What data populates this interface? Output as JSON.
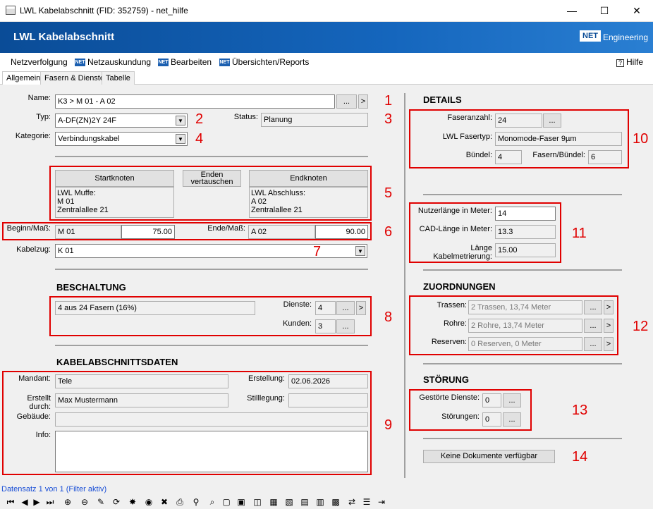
{
  "window": {
    "title": "LWL Kabelabschnitt (FID: 352759) - net_hilfe",
    "min": "—",
    "max": "☐",
    "close": "✕"
  },
  "banner": {
    "title": "LWL Kabelabschnitt",
    "logo": "NET",
    "logo_text": "Engineering"
  },
  "menu": {
    "items": [
      "Netzverfolgung",
      "Netzauskundung",
      "Bearbeiten",
      "Übersichten/Reports"
    ],
    "help": "Hilfe",
    "net": "NET"
  },
  "tabs": [
    "Allgemein",
    "Fasern & Dienste",
    "Tabelle"
  ],
  "general": {
    "name_label": "Name:",
    "name_value": "K3 > M 01 - A 02",
    "dots": "...",
    "arrow": ">",
    "typ_label": "Typ:",
    "typ_value": "A-DF(ZN)2Y 24F",
    "status_label": "Status:",
    "status_value": "Planung",
    "kategorie_label": "Kategorie:",
    "kategorie_value": "Verbindungskabel",
    "startknoten": "Startknoten",
    "enden_vertauschen": "Enden vertauschen",
    "endknoten": "Endknoten",
    "start_info": [
      "LWL Muffe:",
      "M 01",
      "Zentralallee 21"
    ],
    "end_info": [
      "LWL Abschluss:",
      "A 02",
      "Zentralallee 21"
    ],
    "beginn_label": "Beginn/Maß:",
    "beginn_name": "M 01",
    "beginn_mass": "75.00",
    "ende_label": "Ende/Maß:",
    "ende_name": "A 02",
    "ende_mass": "90.00",
    "kabelzug_label": "Kabelzug:",
    "kabelzug_value": "K 01"
  },
  "beschaltung": {
    "title": "BESCHALTUNG",
    "fasern": "4 aus 24 Fasern (16%)",
    "dienste_label": "Dienste:",
    "dienste_value": "4",
    "kunden_label": "Kunden:",
    "kunden_value": "3"
  },
  "kabeldaten": {
    "title": "KABELABSCHNITTSDATEN",
    "mandant_label": "Mandant:",
    "mandant_value": "Tele",
    "erstellung_label": "Erstellung:",
    "erstellung_value": "02.06.2026",
    "erstellt_label": "Erstellt durch:",
    "erstellt_value": "Max Mustermann",
    "stilllegung_label": "Stilllegung:",
    "stilllegung_value": "",
    "gebaeude_label": "Gebäude:",
    "gebaeude_value": "",
    "info_label": "Info:",
    "info_value": ""
  },
  "details": {
    "title": "DETAILS",
    "faseranzahl_label": "Faseranzahl:",
    "faseranzahl_value": "24",
    "fasertyp_label": "LWL Fasertyp:",
    "fasertyp_value": "Monomode-Faser 9µm",
    "buendel_label": "Bündel:",
    "buendel_value": "4",
    "fpb_label": "Fasern/Bündel:",
    "fpb_value": "6"
  },
  "laengen": {
    "nutzer_label": "Nutzerlänge in Meter:",
    "nutzer_value": "14",
    "cad_label": "CAD-Länge in Meter:",
    "cad_value": "13.3",
    "kmetr_label": "Länge Kabelmetrierung:",
    "kmetr_value": "15.00"
  },
  "zuordnungen": {
    "title": "ZUORDNUNGEN",
    "trassen_label": "Trassen:",
    "trassen_value": "2 Trassen, 13,74 Meter",
    "rohre_label": "Rohre:",
    "rohre_value": "2 Rohre, 13,74 Meter",
    "reserven_label": "Reserven:",
    "reserven_value": "0 Reserven, 0 Meter"
  },
  "stoerung": {
    "title": "STÖRUNG",
    "dienste_label": "Gestörte Dienste:",
    "dienste_value": "0",
    "stoerungen_label": "Störungen:",
    "stoerungen_value": "0"
  },
  "dokumente": "Keine Dokumente verfügbar",
  "numbers": [
    "1",
    "2",
    "3",
    "4",
    "5",
    "6",
    "7",
    "8",
    "9",
    "10",
    "11",
    "12",
    "13",
    "14"
  ],
  "status": {
    "text": "Datensatz 1 von 1 (Filter aktiv)"
  },
  "toolbar": [
    "⏮",
    "◀",
    "▶",
    "⏭",
    "⊕",
    "⊖",
    "✎",
    "⟳",
    "✸",
    "◉",
    "✖",
    "⎙",
    "⚲",
    "⌕",
    "▢",
    "▣",
    "◫",
    "▦",
    "▧",
    "▤",
    "▥",
    "▩",
    "⇄",
    "☰",
    "⇥"
  ],
  "colors": {
    "banner": "#1566bd",
    "highlight": "#e00000"
  }
}
